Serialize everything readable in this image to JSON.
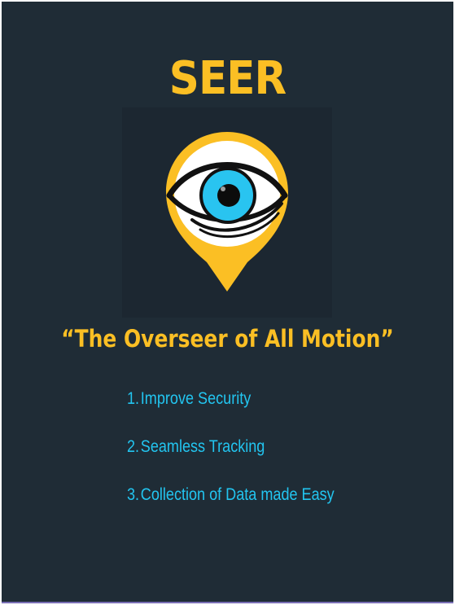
{
  "slide": {
    "title": "SEER",
    "tagline": "“The Overseer of All Motion”",
    "logo": {
      "icon": "eye-location-pin-icon",
      "pin_color": "#fbbf24",
      "iris_color": "#29c4f0",
      "background": "#1c2731"
    },
    "features": [
      {
        "num": "1.",
        "label": "Improve Security"
      },
      {
        "num": "2.",
        "label": "Seamless Tracking"
      },
      {
        "num": "3.",
        "label": "Collection of Data made Easy"
      }
    ]
  },
  "colors": {
    "background": "#1f2c36",
    "accent_yellow": "#fbbf24",
    "accent_cyan": "#22c5f0"
  }
}
